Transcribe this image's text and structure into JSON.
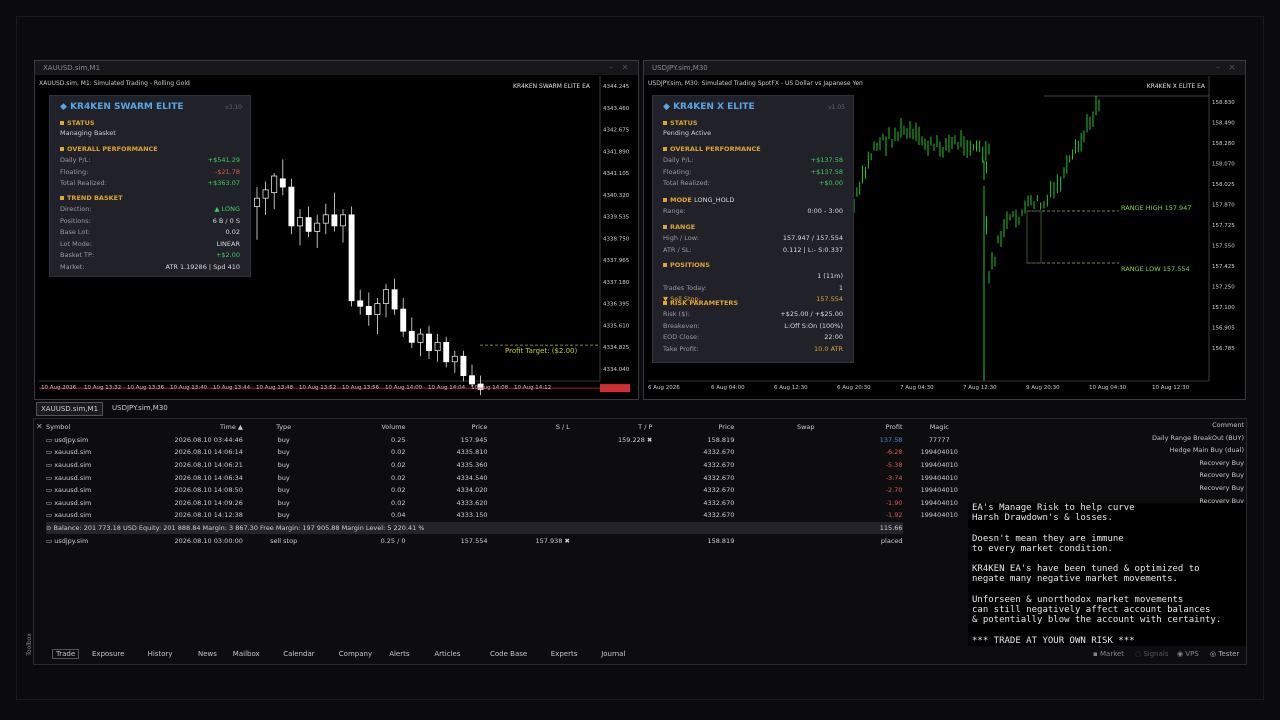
{
  "left_window": {
    "caption": "XAUUSD.sim,M1",
    "chart_title": "XAUUSD.sim, M1:  Simulated Trading - Rolling Gold",
    "ea_tag": "KR4KEN SWARM ELITE EA",
    "price_labels": [
      "4344.245",
      "4343.460",
      "4342.675",
      "4341.890",
      "4341.105",
      "4340.320",
      "4339.535",
      "4338.750",
      "4337.965",
      "4337.180",
      "4336.395",
      "4335.610",
      "4334.825",
      "4334.040"
    ],
    "time_labels": [
      "10 Aug 2026",
      "10 Aug 13:32",
      "10 Aug 13:36",
      "10 Aug 13:40",
      "10 Aug 13:44",
      "10 Aug 13:48",
      "10 Aug 13:52",
      "10 Aug 13:56",
      "10 Aug 14:00",
      "10 Aug 14:04",
      "10 Aug 14:08",
      "10 Aug 14:12"
    ],
    "profit_target_label": "Profit Target: ($2.00)",
    "candles": [
      {
        "o": 4339.9,
        "h": 4340.6,
        "l": 4338.7,
        "c": 4340.2
      },
      {
        "o": 4340.2,
        "h": 4340.8,
        "l": 4339.6,
        "c": 4340.5
      },
      {
        "o": 4340.4,
        "h": 4341.1,
        "l": 4339.8,
        "c": 4341.0
      },
      {
        "o": 4340.9,
        "h": 4341.6,
        "l": 4340.3,
        "c": 4340.6
      },
      {
        "o": 4340.6,
        "h": 4340.9,
        "l": 4338.9,
        "c": 4339.2
      },
      {
        "o": 4339.2,
        "h": 4339.8,
        "l": 4338.5,
        "c": 4339.5
      },
      {
        "o": 4339.5,
        "h": 4339.9,
        "l": 4338.8,
        "c": 4339.0
      },
      {
        "o": 4339.0,
        "h": 4339.6,
        "l": 4338.4,
        "c": 4339.3
      },
      {
        "o": 4339.3,
        "h": 4340.0,
        "l": 4338.9,
        "c": 4339.6
      },
      {
        "o": 4339.6,
        "h": 4340.4,
        "l": 4339.0,
        "c": 4339.2
      },
      {
        "o": 4339.2,
        "h": 4339.8,
        "l": 4338.6,
        "c": 4339.6
      },
      {
        "o": 4339.6,
        "h": 4339.9,
        "l": 4336.3,
        "c": 4336.5
      },
      {
        "o": 4336.5,
        "h": 4336.9,
        "l": 4336.0,
        "c": 4336.3
      },
      {
        "o": 4336.3,
        "h": 4336.8,
        "l": 4335.6,
        "c": 4336.0
      },
      {
        "o": 4336.0,
        "h": 4336.6,
        "l": 4335.3,
        "c": 4336.4
      },
      {
        "o": 4336.4,
        "h": 4337.1,
        "l": 4335.9,
        "c": 4336.9
      },
      {
        "o": 4336.9,
        "h": 4337.3,
        "l": 4336.0,
        "c": 4336.2
      },
      {
        "o": 4336.2,
        "h": 4336.6,
        "l": 4335.2,
        "c": 4335.4
      },
      {
        "o": 4335.4,
        "h": 4335.9,
        "l": 4334.8,
        "c": 4335.0
      },
      {
        "o": 4335.0,
        "h": 4335.5,
        "l": 4334.5,
        "c": 4335.3
      },
      {
        "o": 4335.3,
        "h": 4335.6,
        "l": 4334.4,
        "c": 4334.7
      },
      {
        "o": 4334.7,
        "h": 4335.3,
        "l": 4334.3,
        "c": 4335.0
      },
      {
        "o": 4335.0,
        "h": 4335.2,
        "l": 4334.1,
        "c": 4334.3
      },
      {
        "o": 4334.3,
        "h": 4334.7,
        "l": 4333.9,
        "c": 4334.5
      },
      {
        "o": 4334.5,
        "h": 4334.7,
        "l": 4333.6,
        "c": 4333.8
      },
      {
        "o": 4333.8,
        "h": 4334.2,
        "l": 4333.4,
        "c": 4333.5
      },
      {
        "o": 4333.5,
        "h": 4333.8,
        "l": 4333.1,
        "c": 4333.3
      }
    ],
    "panel": {
      "title": "KR4KEN SWARM ELITE",
      "version": "v3.10",
      "status_h": "STATUS",
      "status_v": "Managing Basket",
      "perf_h": "OVERALL PERFORMANCE",
      "perf": [
        [
          "Daily P/L:",
          "+$541.29"
        ],
        [
          "Floating:",
          "-$21.78"
        ],
        [
          "Total Realized:",
          "+$363.07"
        ]
      ],
      "trend_h": "TREND BASKET",
      "trend": [
        [
          "Direction:",
          "▲ LONG"
        ],
        [
          "Positions:",
          "6 B / 0 S"
        ],
        [
          "Base Lot:",
          "0.02"
        ],
        [
          "Lot Mode:",
          "LINEAR"
        ],
        [
          "Basket TP:",
          "+$2.00"
        ],
        [
          "Market:",
          "ATR 1.19286 | Spd 410"
        ]
      ]
    }
  },
  "right_window": {
    "caption": "USDJPY.sim,M30",
    "chart_title": "USDJPY.sim, M30:  Simulated Trading SpotFX - US Dollar vs Japanese Yen",
    "ea_tag": "KR4KEN X ELITE EA",
    "price_labels": [
      "158.830",
      "158.490",
      "158.280",
      "158.070",
      "158.025",
      "157.870",
      "157.725",
      "157.550",
      "157.425",
      "157.250",
      "157.100",
      "156.905",
      "156.785"
    ],
    "time_labels": [
      "6 Aug 2026",
      "6 Aug 04:00",
      "6 Aug 12:30",
      "6 Aug 20:30",
      "7 Aug 04:30",
      "7 Aug 12:30",
      "9 Aug 20:30",
      "10 Aug 04:30",
      "10 Aug 12:30"
    ],
    "range_high_label": "RANGE HIGH 157.947",
    "range_low_label": "RANGE LOW 157.554",
    "panel": {
      "title": "KR4KEN X ELITE",
      "version": "v1.05",
      "status_h": "STATUS",
      "status_v": "Pending Active",
      "perf_h": "OVERALL PERFORMANCE",
      "perf": [
        [
          "Daily P/L:",
          "+$137.58"
        ],
        [
          "Floating:",
          "+$137.58"
        ],
        [
          "Total Realized:",
          "+$0.00"
        ]
      ],
      "mode_h": "MODE",
      "mode_v": "LONG_HOLD",
      "mode_rows": [
        [
          "Range:",
          "0:00 - 3:00"
        ]
      ],
      "range_h": "RANGE",
      "range_rows": [
        [
          "High / Low:",
          "157.947 / 157.554"
        ],
        [
          "ATR / SL:",
          "0.112 | L:- S:0.337"
        ]
      ],
      "pos_h": "POSITIONS",
      "pos_rows": [
        [
          "",
          "1 (11m)"
        ],
        [
          "Trades Today:",
          "1"
        ],
        [
          "▼ Sell Stop:",
          "157.554"
        ]
      ],
      "risk_h": "RISK PARAMETERS",
      "risk_rows": [
        [
          "Risk ($):",
          "+$25.00 / +$25.00"
        ],
        [
          "Breakeven:",
          "L:Off S:On (100%)"
        ],
        [
          "EOD Close:",
          "22:00"
        ],
        [
          "Take Profit:",
          "10.0 ATR"
        ]
      ]
    }
  },
  "chart_tabs": [
    "XAUUSD.sim,M1",
    "USDJPY.sim,M30"
  ],
  "toolbox": {
    "headers": [
      "Symbol",
      "Time ▲",
      "Type",
      "Volume",
      "Price",
      "S / L",
      "T / P",
      "Price",
      "Swap",
      "Profit",
      "Magic",
      "Comment"
    ],
    "rows": [
      [
        "usdjpy.sim",
        "2026.08.10 03:44:46",
        "buy",
        "0.25",
        "157.945",
        "",
        "159.228 ✖",
        "158.819",
        "",
        "137.58",
        "77777",
        "Daily Range BreakOut (BUY)"
      ],
      [
        "xauusd.sim",
        "2026.08.10 14:06:14",
        "buy",
        "0.02",
        "4335.810",
        "",
        "",
        "4332.670",
        "",
        "-6.28",
        "199404010",
        "Hedge Main Buy (dual)"
      ],
      [
        "xauusd.sim",
        "2026.08.10 14:06:21",
        "buy",
        "0.02",
        "4335.360",
        "",
        "",
        "4332.670",
        "",
        "-5.38",
        "199404010",
        "Recovery Buy"
      ],
      [
        "xauusd.sim",
        "2026.08.10 14:06:34",
        "buy",
        "0.02",
        "4334.540",
        "",
        "",
        "4332.670",
        "",
        "-3.74",
        "199404010",
        "Recovery Buy"
      ],
      [
        "xauusd.sim",
        "2026.08.10 14:08:50",
        "buy",
        "0.02",
        "4334.020",
        "",
        "",
        "4332.670",
        "",
        "-2.70",
        "199404010",
        "Recovery Buy"
      ],
      [
        "xauusd.sim",
        "2026.08.10 14:09:26",
        "buy",
        "0.02",
        "4333.620",
        "",
        "",
        "4332.670",
        "",
        "-1.90",
        "199404010",
        "Recovery Buy"
      ],
      [
        "xauusd.sim",
        "2026.08.10 14:12:38",
        "buy",
        "0.04",
        "4333.150",
        "",
        "",
        "4332.670",
        "",
        "-1.92",
        "199404010",
        "Recovery Buy"
      ]
    ],
    "balance_line": "Balance: 201 773.18 USD  Equity: 201 888.84  Margin: 3 867.30  Free Margin: 197 905.88  Margin Level: 5 220.41 %",
    "balance_profit": "115.66",
    "pending": [
      "usdjpy.sim",
      "2026.08.10 03:00:00",
      "sell stop",
      "0.25 / 0",
      "157.554",
      "157.938 ✖",
      "",
      "158.819",
      "",
      "placed",
      "",
      "SELL HEDGE"
    ],
    "bottom_tabs": [
      "Trade",
      "Exposure",
      "History",
      "News",
      "Mailbox",
      "Calendar",
      "Company",
      "Alerts",
      "Articles",
      "Code Base",
      "Experts",
      "Journal"
    ],
    "toolbox_label": "Toolbox"
  },
  "overlay_text": [
    "EA's Manage Risk to help curve",
    "Harsh Drawdown's & losses.",
    "",
    "Doesn't mean they are immune",
    "to every market condition.",
    "",
    "KR4KEN EA's have been tuned & optimized to",
    "negate many negative market movements.",
    "",
    "Unforseen & unorthodox market movements",
    "can still negatively affect account balances",
    "& potentially blow the account with certainty.",
    "",
    "*** TRADE AT YOUR OWN RISK ***"
  ],
  "status": {
    "market": "Market",
    "signals": "Signals",
    "vps": "VPS",
    "tester": "Tester"
  },
  "colors": {
    "up": "#ffffff",
    "down": "#ffffff",
    "gold_line": "#e0a431",
    "green_line": "#27d82f",
    "profit_line": "#b8b820",
    "red_line": "#d23030"
  }
}
